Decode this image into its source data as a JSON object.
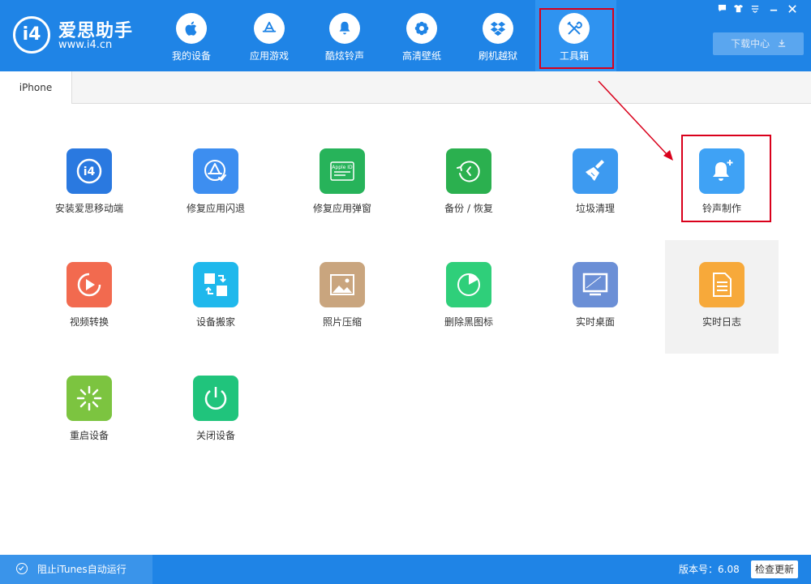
{
  "app": {
    "logo_glyph": "i4",
    "title": "爱思助手",
    "url": "www.i4.cn"
  },
  "nav": [
    {
      "label": "我的设备",
      "icon": "apple-icon"
    },
    {
      "label": "应用游戏",
      "icon": "app-store-icon"
    },
    {
      "label": "酷炫铃声",
      "icon": "bell-icon"
    },
    {
      "label": "高清壁纸",
      "icon": "flower-icon"
    },
    {
      "label": "刷机越狱",
      "icon": "dropbox-icon"
    },
    {
      "label": "工具箱",
      "icon": "tools-icon"
    }
  ],
  "window_controls": [
    "message-icon",
    "shirt-icon",
    "menu-icon",
    "minimize-icon",
    "close-icon"
  ],
  "download_center": "下载中心",
  "tab": "iPhone",
  "tools": [
    {
      "label": "安装爱思移动端",
      "color": "#2a79e0"
    },
    {
      "label": "修复应用闪退",
      "color": "#3d8ef0"
    },
    {
      "label": "修复应用弹窗",
      "color": "#27b35a",
      "icon_text": "Apple ID"
    },
    {
      "label": "备份 / 恢复",
      "color": "#2bb04f"
    },
    {
      "label": "垃圾清理",
      "color": "#3d9af0"
    },
    {
      "label": "铃声制作",
      "color": "#3fa2f5"
    },
    {
      "label": "视频转换",
      "color": "#f26a4f"
    },
    {
      "label": "设备搬家",
      "color": "#1fb8ec"
    },
    {
      "label": "照片压缩",
      "color": "#c9a57e"
    },
    {
      "label": "删除黑图标",
      "color": "#2fcf7a"
    },
    {
      "label": "实时桌面",
      "color": "#6b8fd6"
    },
    {
      "label": "实时日志",
      "color": "#f7a93a"
    },
    {
      "label": "重启设备",
      "color": "#7cc440"
    },
    {
      "label": "关闭设备",
      "color": "#20c47c"
    }
  ],
  "status": {
    "itunes": "阻止iTunes自动运行",
    "version": "版本号：6.08",
    "update": "检查更新"
  }
}
